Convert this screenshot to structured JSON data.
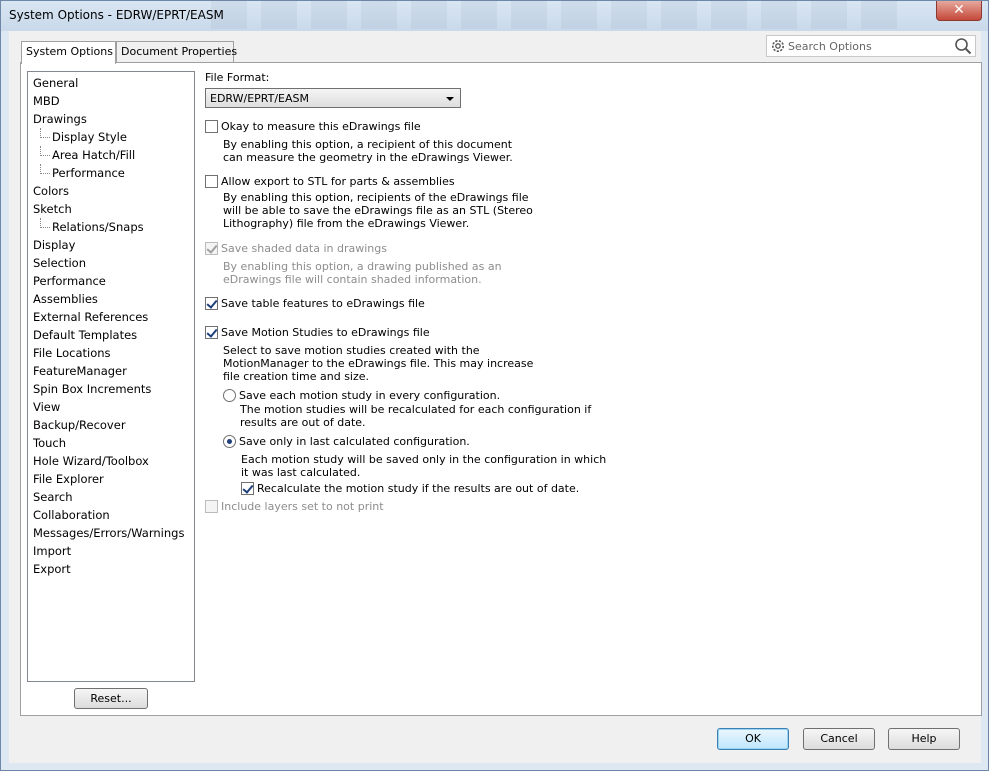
{
  "window": {
    "title": "System Options - EDRW/EPRT/EASM",
    "close_glyph": "✕"
  },
  "tabs": [
    {
      "label": "System Options"
    },
    {
      "label": "Document Properties"
    }
  ],
  "search": {
    "placeholder": "Search Options"
  },
  "tree": {
    "items": [
      {
        "label": "General"
      },
      {
        "label": "MBD"
      },
      {
        "label": "Drawings"
      },
      {
        "label": "Display Style"
      },
      {
        "label": "Area Hatch/Fill"
      },
      {
        "label": "Performance"
      },
      {
        "label": "Colors"
      },
      {
        "label": "Sketch"
      },
      {
        "label": "Relations/Snaps"
      },
      {
        "label": "Display"
      },
      {
        "label": "Selection"
      },
      {
        "label": "Performance"
      },
      {
        "label": "Assemblies"
      },
      {
        "label": "External References"
      },
      {
        "label": "Default Templates"
      },
      {
        "label": "File Locations"
      },
      {
        "label": "FeatureManager"
      },
      {
        "label": "Spin Box Increments"
      },
      {
        "label": "View"
      },
      {
        "label": "Backup/Recover"
      },
      {
        "label": "Touch"
      },
      {
        "label": "Hole Wizard/Toolbox"
      },
      {
        "label": "File Explorer"
      },
      {
        "label": "Search"
      },
      {
        "label": "Collaboration"
      },
      {
        "label": "Messages/Errors/Warnings"
      },
      {
        "label": "Import"
      },
      {
        "label": "Export"
      }
    ],
    "reset_label": "Reset..."
  },
  "export": {
    "file_format_label": "File Format:",
    "file_format_value": "EDRW/EPRT/EASM",
    "okay_measure": {
      "label": "Okay to measure this eDrawings file",
      "checked": false,
      "desc": "By enabling this option, a recipient of this document\ncan measure the geometry in the eDrawings Viewer."
    },
    "allow_stl": {
      "label": "Allow export to STL for parts & assemblies",
      "checked": false,
      "desc": "By enabling this option, recipients of the eDrawings file\nwill be able to save the eDrawings file as an STL (Stereo\nLithography) file from the eDrawings Viewer."
    },
    "save_shaded": {
      "label": "Save shaded data in drawings",
      "checked": true,
      "enabled": false,
      "desc": "By enabling this option, a drawing published as an\neDrawings file will contain shaded information."
    },
    "save_table": {
      "label": "Save table features to eDrawings file",
      "checked": true
    },
    "save_motion": {
      "label": "Save Motion Studies to eDrawings file",
      "checked": true,
      "desc": "Select to save motion studies created with the\nMotionManager to the eDrawings file.  This may increase\nfile creation time and size."
    },
    "motion_every": {
      "label": "Save each motion study in every configuration.",
      "selected": false,
      "desc": "The motion studies will be recalculated for each configuration if\nresults are out of date."
    },
    "motion_last": {
      "label": "Save only in last calculated configuration.",
      "selected": true,
      "desc": "Each motion study will be saved only in the configuration in which\nit was last calculated."
    },
    "recalculate": {
      "label": "Recalculate the motion study if the results are out of date.",
      "checked": true
    },
    "include_layers": {
      "label": "Include layers set to not print",
      "checked": false,
      "enabled": false
    }
  },
  "buttons": {
    "ok": "OK",
    "cancel": "Cancel",
    "help": "Help"
  },
  "colors": {
    "title_bar": "#c9d9ea",
    "close_button": "#c5493a",
    "checkmark": "#1e3f7a",
    "disabled_text": "#8d8d8d"
  }
}
